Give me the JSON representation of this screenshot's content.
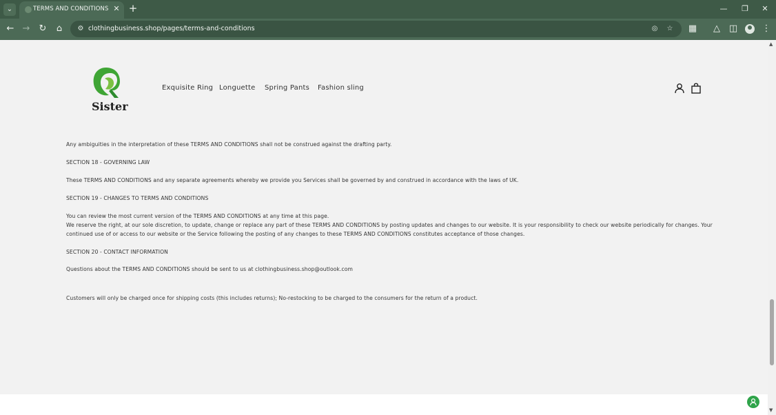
{
  "browser": {
    "tab_title": "TERMS AND CONDITIONS",
    "url": "clothingbusiness.shop/pages/terms-and-conditions"
  },
  "site": {
    "logo_text": "Sister",
    "nav": [
      "Exquisite Ring",
      "Longuette",
      "Spring Pants",
      "Fashion sling"
    ]
  },
  "content": {
    "lines": [
      "Any ambiguities in the interpretation of these TERMS AND CONDITIONS shall not be construed against the drafting party.",
      "SECTION 18 - GOVERNING LAW",
      "These TERMS AND CONDITIONS and any separate agreements whereby we provide you Services shall be governed by and construed in accordance with the laws of UK.",
      "SECTION 19 - CHANGES TO TERMS AND CONDITIONS",
      "You can review the most current version of the TERMS AND CONDITIONS at any time at this page.",
      "We reserve the right, at our sole discretion, to update, change or replace any part of these TERMS AND CONDITIONS by posting updates and changes to our website. It is your responsibility to check our website periodically for changes. Your",
      "continued use of or access to our website or the Service following the posting of any changes to these TERMS AND CONDITIONS constitutes acceptance of those changes.",
      "SECTION 20 - CONTACT INFORMATION",
      "Questions about the TERMS AND CONDITIONS should be sent to us at clothingbusiness.shop@outlook.com",
      "Customers will only be charged once for shipping costs (this includes returns); No-restocking to be charged to the consumers for the return of a product."
    ]
  },
  "colors": {
    "chrome_tabbar": "#3e5a47",
    "chrome_toolbar": "#4c6a56",
    "logo_green": "#3fa535",
    "chat_green": "#2fa44a"
  }
}
